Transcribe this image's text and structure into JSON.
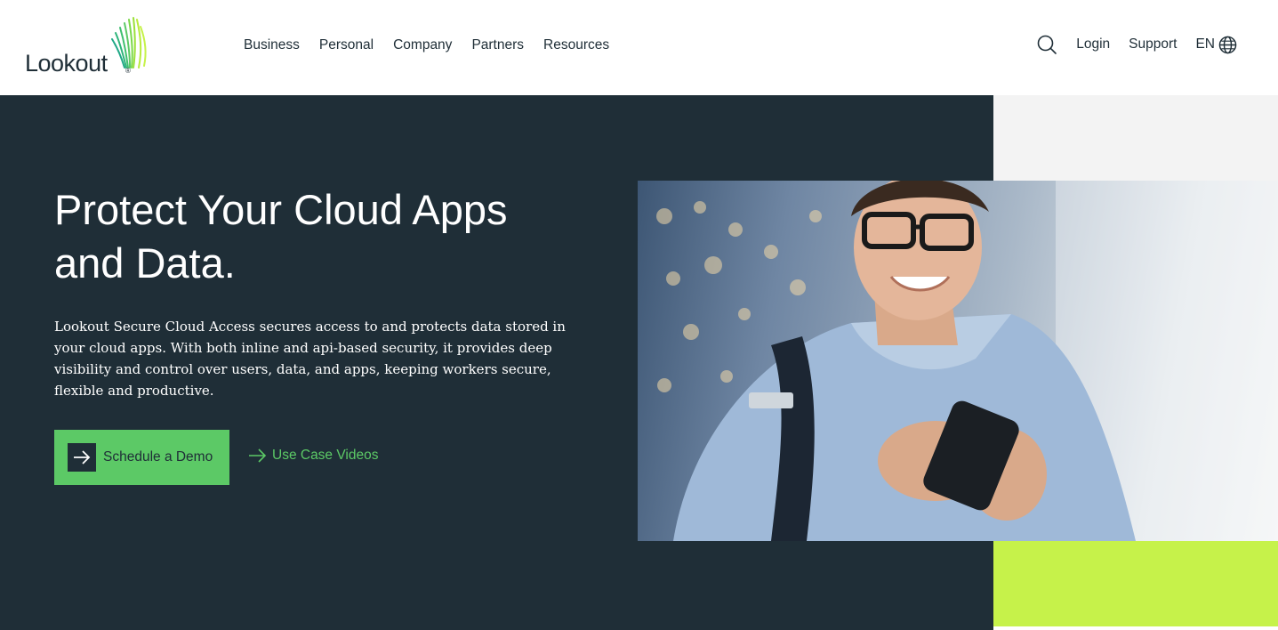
{
  "brand": {
    "name": "Lookout",
    "reg": "®"
  },
  "nav": {
    "items": [
      {
        "label": "Business"
      },
      {
        "label": "Personal"
      },
      {
        "label": "Company"
      },
      {
        "label": "Partners"
      },
      {
        "label": "Resources"
      }
    ]
  },
  "utility": {
    "search_icon": "search-icon",
    "login": "Login",
    "support": "Support",
    "language": "EN",
    "globe_icon": "globe-icon"
  },
  "hero": {
    "title": "Protect Your Cloud Apps and Data.",
    "description": "Lookout Secure Cloud Access secures access to and protects data stored in your cloud apps. With both inline and api-based security, it provides deep visibility and control over users, data, and apps, keeping workers secure, flexible and productive.",
    "primary_cta": "Schedule a Demo",
    "secondary_cta": "Use Case Videos"
  },
  "colors": {
    "dark": "#1f2e37",
    "green": "#5cc966",
    "lime": "#c6f24a",
    "light_gray": "#f3f3f3"
  }
}
